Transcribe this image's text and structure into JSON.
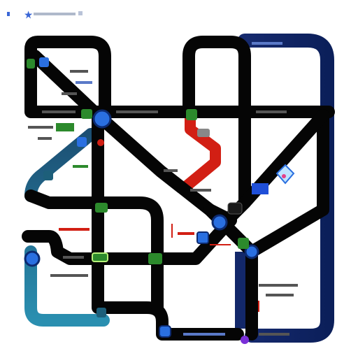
{
  "colors": {
    "track": "#050505",
    "accent_blue": "#1f3f8f",
    "teal": "#1d5f7a",
    "red": "#d21f14",
    "green": "#2c8a2c",
    "station_blue": "#2a6fe0",
    "purple": "#7a2fd8"
  },
  "icons": {
    "header_icon": "star-icon",
    "legend_icon": "diamond-gem-icon"
  }
}
